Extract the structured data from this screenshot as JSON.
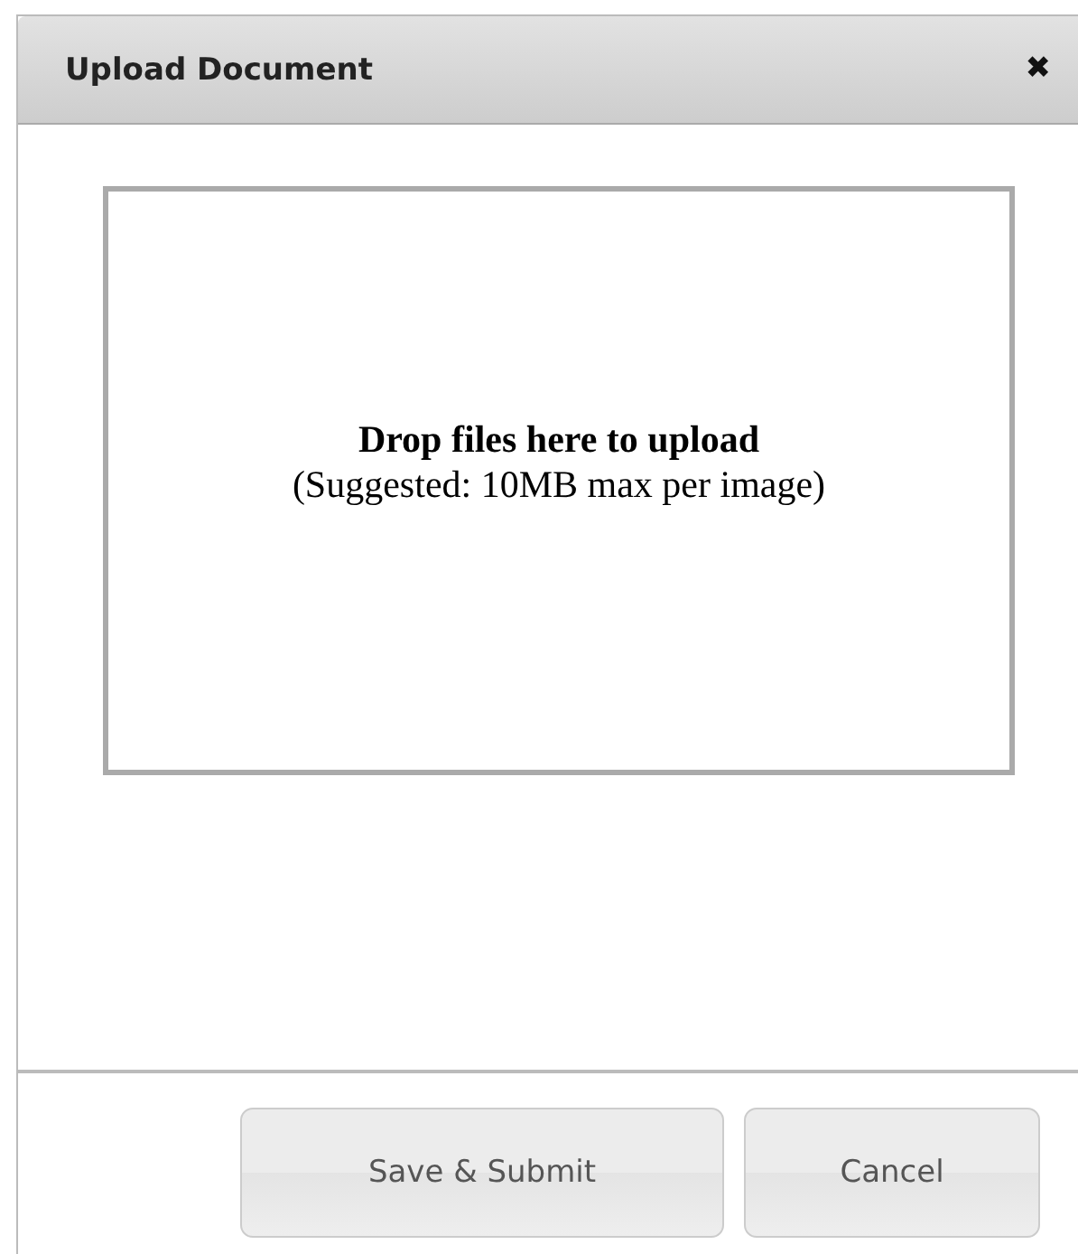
{
  "dialog": {
    "title": "Upload Document",
    "close": "✖"
  },
  "dropzone": {
    "heading": "Drop files here to upload",
    "hint": "(Suggested: 10MB max per image)"
  },
  "buttons": [
    {
      "label": "Save & Submit"
    },
    {
      "label": "Cancel"
    }
  ]
}
